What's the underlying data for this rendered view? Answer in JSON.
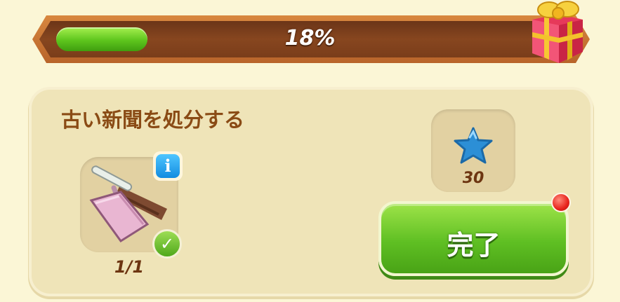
{
  "progress": {
    "value_text": "18%",
    "fraction": 0.18
  },
  "task": {
    "title": "古い新聞を処分する",
    "item": {
      "icon": "dustpan-and-brush-icon",
      "count_text": "1/1",
      "info_label": "i",
      "check_label": "✓"
    },
    "reward": {
      "icon": "blue-star-icon",
      "amount": "30"
    },
    "complete_button_label": "完了"
  },
  "colors": {
    "progress_green": "#5dc51d",
    "title_brown": "#8a4b15",
    "button_green": "#5fbf23",
    "star_blue": "#2c8fd6"
  }
}
